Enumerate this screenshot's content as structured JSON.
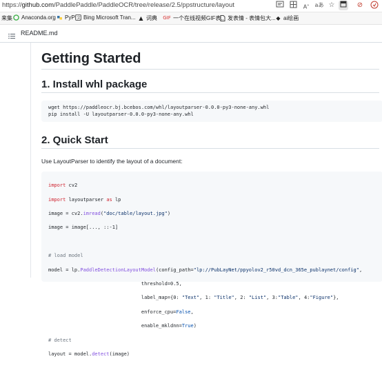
{
  "browser": {
    "url_prefix": "https://",
    "url_host": "github.com",
    "url_path": "/PaddlePaddle/PaddleOCR/tree/release/2.5/ppstructure/layout",
    "toolbar_icons": [
      "read-view-icon",
      "grid-icon",
      "read-aloud-icon",
      "translate-icon",
      "star-icon",
      "tab-actions-icon",
      "extension-icon",
      "more-icon"
    ]
  },
  "bookmarks": [
    {
      "label": "来集",
      "icon": ""
    },
    {
      "label": "Anaconda.org",
      "icon": "anaconda-icon"
    },
    {
      "label": "PyPI",
      "icon": "pypi-icon"
    },
    {
      "label": "Bing Microsoft Tran...",
      "icon": "bing-icon"
    },
    {
      "label": "词典",
      "icon": "dictionary-icon"
    },
    {
      "label": "一个在线视频GIF表...",
      "icon": "gif-icon"
    },
    {
      "label": "发表情 - 表情包大...",
      "icon": "doc-icon"
    },
    {
      "label": "ai绘画",
      "icon": "ai-icon"
    }
  ],
  "readme": {
    "file_name": "README.md"
  },
  "article": {
    "title": "Getting Started",
    "section1_title": "1. Install whl package",
    "code1_lines": [
      "wget https://paddleocr.bj.bcebos.com/whl/layoutparser-0.0.0-py3-none-any.whl",
      "pip install -U layoutparser-0.0.0-py3-none-any.whl"
    ],
    "section2_title": "2. Quick Start",
    "section2_desc": "Use LayoutParser to identify the layout of a document:",
    "code2": {
      "l1_kw": "import",
      "l1_rest": " cv2",
      "l2_kw": "import",
      "l2_mid": " layoutparser ",
      "l2_kw2": "as",
      "l2_rest": " lp",
      "l3_a": "image = cv2.",
      "l3_fn": "imread",
      "l3_b": "(",
      "l3_str": "\"doc/table/layout.jpg\"",
      "l3_c": ")",
      "l4": "image = image[..., ::-1]",
      "l5": "",
      "l6_cm": "# load model",
      "l7_a": "model = lp.",
      "l7_fn": "PaddleDetectionLayoutModel",
      "l7_b": "(config_path=",
      "l7_str": "\"lp://PubLayNet/ppyolov2_r50vd_dcn_365e_publaynet/config\"",
      "l7_c": ",",
      "l8": "                                threshold=0.5,",
      "l9_a": "                                label_map={0: ",
      "l9_s1": "\"Text\"",
      "l9_b": ", 1: ",
      "l9_s2": "\"Title\"",
      "l9_c": ", 2: ",
      "l9_s3": "\"List\"",
      "l9_d": ", 3:",
      "l9_s4": "\"Table\"",
      "l9_e": ", 4:",
      "l9_s5": "\"Figure\"",
      "l9_f": "},",
      "l10_a": "                                enforce_cpu=",
      "l10_kw": "False",
      "l10_b": ",",
      "l11_a": "                                enable_mkldnn=",
      "l11_kw": "True",
      "l11_b": ")",
      "l12_cm": "# detect",
      "l13_a": "layout = model.",
      "l13_fn": "detect",
      "l13_b": "(image)"
    }
  },
  "colors": {
    "heading": "#1f2328",
    "code_bg": "#f6f8fa",
    "keyword": "#cf222e",
    "string": "#0a3069",
    "function": "#8250df",
    "comment": "#6e7781"
  }
}
